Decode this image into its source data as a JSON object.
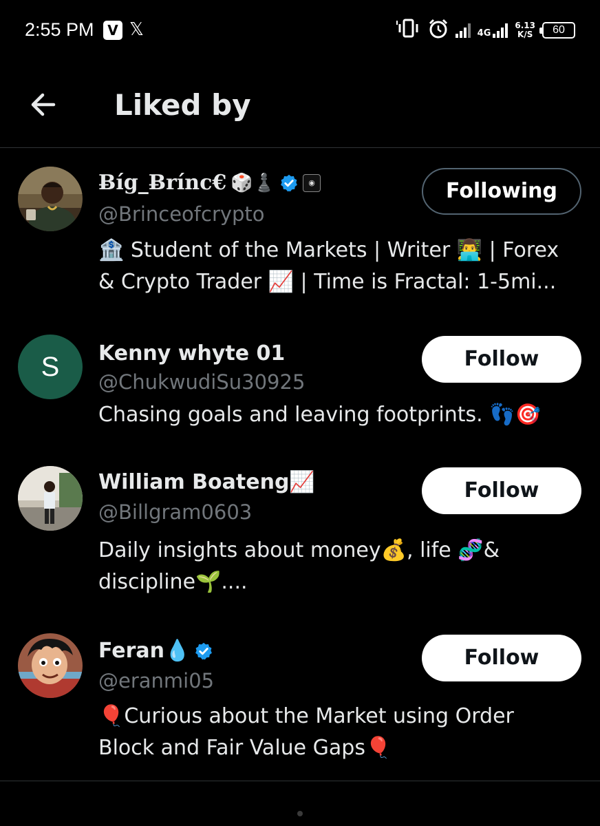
{
  "status_bar": {
    "time": "2:55 PM",
    "app_icon_1": "V",
    "app_icon_2": "𝕏",
    "network": "4G",
    "speed_top": "6.13",
    "speed_bottom": "K/S",
    "battery": "60"
  },
  "header": {
    "title": "Liked by"
  },
  "users": [
    {
      "name": "Ƀíg_Ƀrínc€",
      "name_emojis": "🎲♟️",
      "verified": true,
      "handle": "@Brinceofcrypto",
      "button": "Following",
      "bio_line1": "🏦 Student of the Markets | Writer 👨‍💻 | Forex",
      "bio_line2": "& Crypto Trader 📈 | Time is Fractal: 1-5mi..."
    },
    {
      "name": "Kenny whyte 01",
      "avatar_letter": "S",
      "handle": "@ChukwudiSu30925",
      "button": "Follow",
      "bio_line1": "Chasing goals and leaving footprints. 👣🎯"
    },
    {
      "name": "William Boateng📈",
      "handle": "@Billgram0603",
      "button": "Follow",
      "bio_line1": "Daily insights about money💰, life 🧬&",
      "bio_line2": "discipline🌱...."
    },
    {
      "name": "Feran💧",
      "verified": true,
      "handle": "@eranmi05",
      "button": "Follow",
      "bio_line1": "🎈Curious about the Market using Order",
      "bio_line2": "Block and Fair Value Gaps🎈"
    }
  ],
  "colors": {
    "background": "#000000",
    "text_primary": "#e7e9ea",
    "text_secondary": "#71767b",
    "verified_blue": "#1d9bf0",
    "divider": "#2f3336",
    "avatar_s_bg": "#1a5c48"
  }
}
